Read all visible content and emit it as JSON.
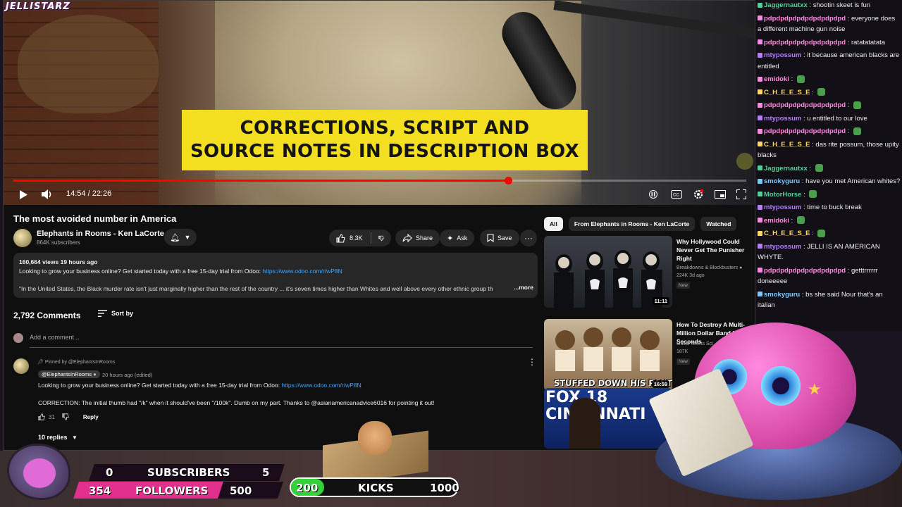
{
  "stream": {
    "channel_logo": "JELLISTARZ"
  },
  "video": {
    "banner_line1": "CORRECTIONS, SCRIPT AND",
    "banner_line2": "SOURCE NOTES  IN DESCRIPTION BOX",
    "time": "14:54 / 22:26",
    "progress": 0.675,
    "icons": [
      "play-icon",
      "volume-icon",
      "pause-icon",
      "captions-icon",
      "settings-icon",
      "miniplayer-icon",
      "fullscreen-icon"
    ]
  },
  "watch": {
    "title": "The most avoided number in America",
    "channel_name": "Elephants in Rooms - Ken LaCorte",
    "subscribers": "864K subscribers",
    "likes": "8.3K",
    "share_label": "Share",
    "ask_label": "Ask",
    "save_label": "Save"
  },
  "description": {
    "meta": "160,664 views  19 hours ago",
    "line1_prefix": "Looking to grow your business online? Get started today with a free 15-day trial from Odoo: ",
    "link": "https://www.odoo.com/r/wP8N",
    "quote": "\"In the United States, the Black murder rate isn't just marginally higher than the rest of the country ... it's seven times higher than Whites and well above every other ethnic group th",
    "more": "...more"
  },
  "comments": {
    "count": "2,792 Comments",
    "sort_label": "Sort by",
    "add_placeholder": "Add a comment...",
    "pinned": "Pinned by @ElephantsInRooms",
    "author": "@ElephantsInRooms",
    "time": "20 hours ago (edited)",
    "text1_prefix": "Looking to grow your business online? Get started today with a free 15-day trial from Odoo: ",
    "text1_link": "https://www.odoo.com/r/wP8N",
    "text2": "CORRECTION: The initial thumb had \"/k\" when it should've been \"/100k\". Dumb on my part.  Thanks to @asianamericanadvice6016 for pointing it out!",
    "likes": "31",
    "reply_label": "Reply",
    "replies": "10 replies"
  },
  "chips": [
    "All",
    "From Elephants in Rooms - Ken LaCorte",
    "Watched"
  ],
  "recommendations": [
    {
      "title": "Why Hollywood Could Never Get The Punisher Right",
      "channel": "Breakdowns & Blockbusters",
      "views": "224K  3d ago",
      "badge": "New",
      "duration": "11:11"
    },
    {
      "title": "How To Destroy A Multi-Million Dollar Band In 6 Seconds",
      "channel": "Guitar Meets Sci",
      "views": "187K",
      "badge": "New",
      "duration": "16:59",
      "thumb_text": "STUFFED DOWN HIS PANTS"
    },
    {
      "title": "",
      "channel": "",
      "views": "",
      "badge": "",
      "duration": "",
      "thumb_text": "FOX 18 CINCINNATI"
    }
  ],
  "chat": [
    {
      "user": "Jaggernautxx",
      "color": "#4dd39a",
      "text": "shootin skeet is fun"
    },
    {
      "user": "pdpdpdpdpdpdpdpdpdpd",
      "color": "#ff8ae0",
      "text": "everyone does a different machine gun noise"
    },
    {
      "user": "pdpdpdpdpdpdpdpdpdpd",
      "color": "#ff8ae0",
      "text": "ratatatatata"
    },
    {
      "user": "mtypossum",
      "color": "#b57cff",
      "text": "it because american blacks are entitled"
    },
    {
      "user": "emidoki",
      "color": "#ff8ae0",
      "text": ""
    },
    {
      "user": "C_H_E_E_S_E",
      "color": "#ffd95a",
      "text": ""
    },
    {
      "user": "pdpdpdpdpdpdpdpdpdpd",
      "color": "#ff8ae0",
      "text": ""
    },
    {
      "user": "mtypossum",
      "color": "#b57cff",
      "text": "u entitled to our love"
    },
    {
      "user": "pdpdpdpdpdpdpdpdpdpd",
      "color": "#ff8ae0",
      "text": ""
    },
    {
      "user": "C_H_E_E_S_E",
      "color": "#ffd95a",
      "text": "das rite possum, those upity blacks"
    },
    {
      "user": "Jaggernautxx",
      "color": "#4dd39a",
      "text": ""
    },
    {
      "user": "smokyguru",
      "color": "#7ec8ff",
      "text": "have you met American whites?"
    },
    {
      "user": "MotorHorse",
      "color": "#4dd39a",
      "text": ""
    },
    {
      "user": "mtypossum",
      "color": "#b57cff",
      "text": "time to buck break"
    },
    {
      "user": "emidoki",
      "color": "#ff8ae0",
      "text": ""
    },
    {
      "user": "C_H_E_E_S_E",
      "color": "#ffd95a",
      "text": ""
    },
    {
      "user": "mtypossum",
      "color": "#b57cff",
      "text": "JELLI IS AN AMERICAN WHYTE."
    },
    {
      "user": "pdpdpdpdpdpdpdpdpdpd",
      "color": "#ff8ae0",
      "text": "getttrrrrrr doneeeee"
    },
    {
      "user": "smokyguru",
      "color": "#7ec8ff",
      "text": "bs she said Nour that's an italian"
    }
  ],
  "goals": {
    "subscribers_label": "SUBSCRIBERS",
    "subscribers_current": "0",
    "subscribers_target": "5",
    "followers_label": "FOLLOWERS",
    "followers_current": "354",
    "followers_target": "500",
    "kicks_label": "KICKS",
    "kicks_current": "200",
    "kicks_target": "1000",
    "kicks_fraction": 0.2
  }
}
